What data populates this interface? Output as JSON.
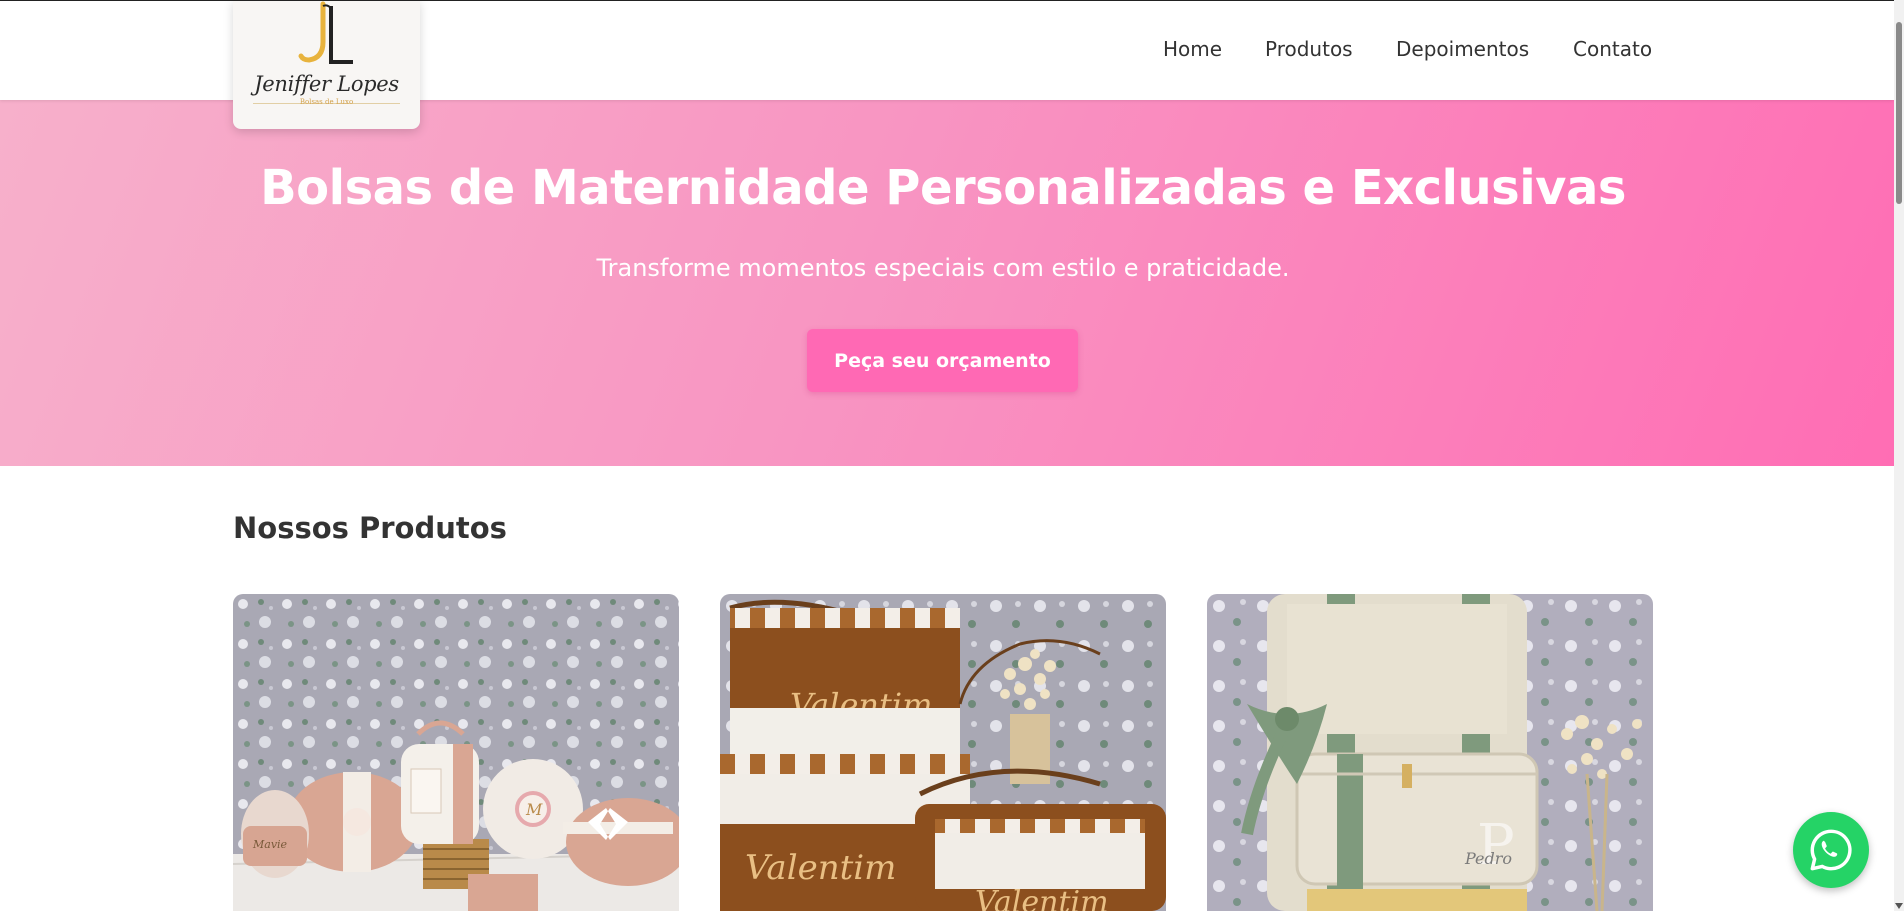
{
  "brand": {
    "name": "Jeniffer Lopes",
    "tagline": "Bolsas de Luxo"
  },
  "nav": {
    "items": [
      {
        "label": "Home"
      },
      {
        "label": "Produtos"
      },
      {
        "label": "Depoimentos"
      },
      {
        "label": "Contato"
      }
    ]
  },
  "hero": {
    "title": "Bolsas de Maternidade Personalizadas e Exclusivas",
    "subtitle": "Transforme momentos especiais com estilo e praticidade.",
    "cta_label": "Peça seu orçamento"
  },
  "products": {
    "heading": "Nossos Produtos",
    "cards": [
      {
        "embroidery": [
          "Mavie",
          "M"
        ]
      },
      {
        "embroidery": [
          "Valentim",
          "Valentim",
          "Valentim"
        ]
      },
      {
        "embroidery": [
          "P",
          "Pedro"
        ]
      }
    ]
  },
  "floating": {
    "icon": "whatsapp-icon"
  },
  "colors": {
    "accent": "#ff69b4",
    "hero_gradient_start": "#f7b0cb",
    "hero_gradient_end": "#ff6db4",
    "whatsapp": "#25d366",
    "text": "#333333"
  }
}
